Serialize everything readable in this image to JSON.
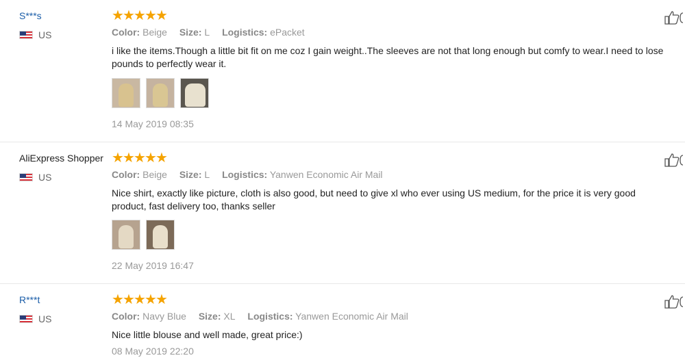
{
  "reviews": [
    {
      "user": "S***s",
      "country": "US",
      "rating": 5,
      "color_label": "Color:",
      "color": "Beige",
      "size_label": "Size:",
      "size": "L",
      "logistics_label": "Logistics:",
      "logistics": "ePacket",
      "text_line1": "i like the items.Though a little bit fit on me coz I gain weight..The sleeves are not that long enough but comfy to wear.I need to lose",
      "text_line2": "pounds to perfectly wear it.",
      "photos": 3,
      "date": "14 May 2019 08:35"
    },
    {
      "user": "AliExpress Shopper",
      "country": "US",
      "rating": 5,
      "color_label": "Color:",
      "color": "Beige",
      "size_label": "Size:",
      "size": "L",
      "logistics_label": "Logistics:",
      "logistics": "Yanwen Economic Air Mail",
      "text_line1": "Nice shirt, exactly like picture, cloth is also good, but need to give xl who ever using US medium, for the price it is very good",
      "text_line2": "product, fast delivery too, thanks seller",
      "photos": 2,
      "date": "22 May 2019 16:47"
    },
    {
      "user": "R***t",
      "country": "US",
      "rating": 5,
      "color_label": "Color:",
      "color": "Navy Blue",
      "size_label": "Size:",
      "size": "XL",
      "logistics_label": "Logistics:",
      "logistics": "Yanwen Economic Air Mail",
      "text_line1": "Nice little blouse and well made, great price:)",
      "date": "08 May 2019 22:20"
    }
  ],
  "colors": {
    "star": "#f5a300",
    "username_link": "#1a5da8"
  },
  "icons": [
    "us-flag-icon",
    "star-icon",
    "thumbs-up-icon",
    "review-photo"
  ]
}
